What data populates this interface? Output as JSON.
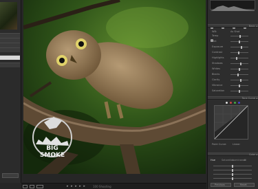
{
  "left_panel": {
    "selected_row_index": 6
  },
  "canvas": {
    "watermark_line1": "BIG SMOKE",
    "watermark_line2": "BIRDING"
  },
  "film_strip": {
    "dots": "▸ ▸ ▸ ▸ ▸",
    "label": "100 Shooting"
  },
  "right_panel": {
    "basic_section": "Basic ◂",
    "wb_label": "WB:",
    "wb_value": "As Shot",
    "adjust_rows": [
      "Temp",
      "Tint",
      "Exposure",
      "Contrast",
      "Highlights",
      "Shadows",
      "Whites",
      "Blacks",
      "Clarity",
      "Vibrance",
      "Saturation"
    ],
    "adjust_values": [
      0.55,
      0.48,
      0.62,
      0.45,
      0.35,
      0.6,
      0.5,
      0.4,
      0.58,
      0.52,
      0.5
    ],
    "tone_curve_section": "Tone Curve ◂",
    "point_curve_label": "Point Curve:",
    "point_curve_value": "Linear",
    "hsl_section": "Color ◂",
    "hsl_tabs": [
      "Hue",
      "Saturation",
      "Luminance",
      "All"
    ],
    "prev_button": "Previous",
    "reset_button": "Reset"
  }
}
